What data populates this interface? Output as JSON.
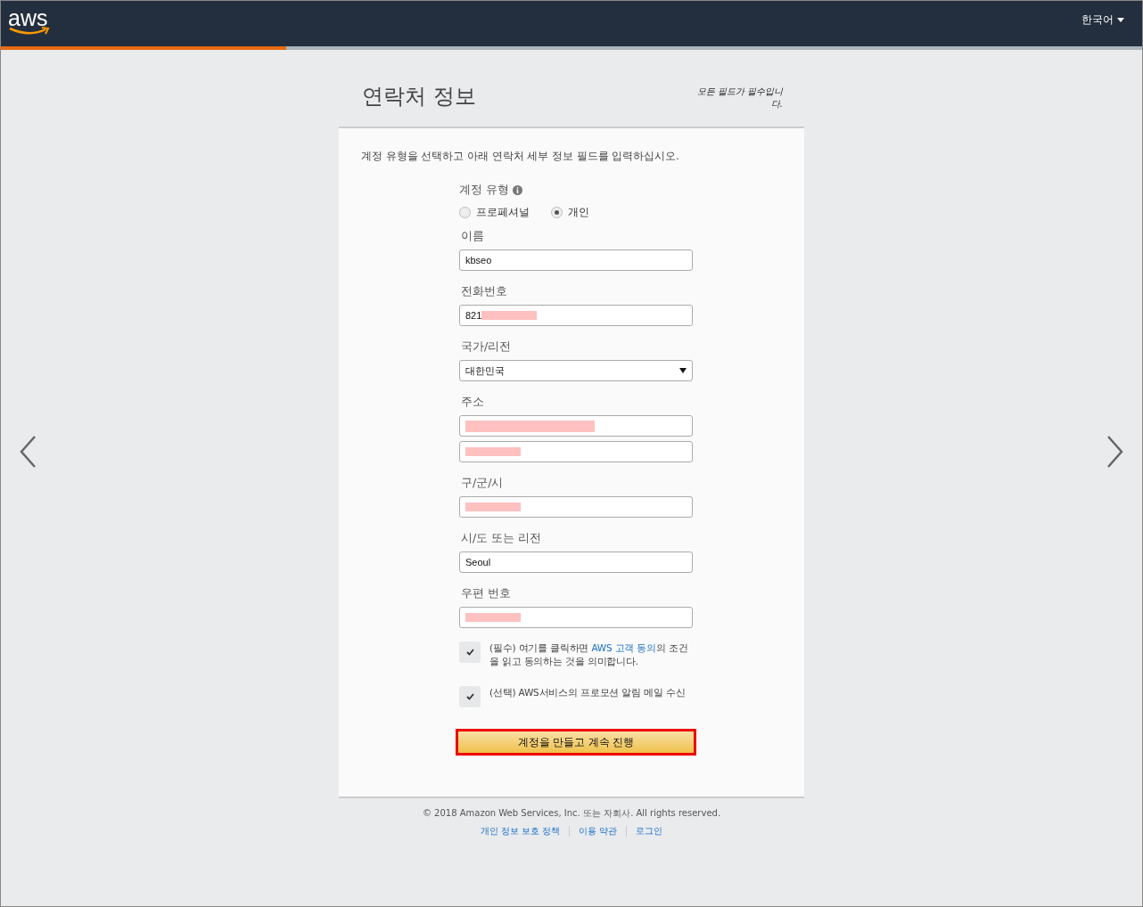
{
  "header": {
    "logo": "aws",
    "language": "한국어"
  },
  "progress": {
    "level": 0.25
  },
  "title": "연락처 정보",
  "required_note": "모든 필드가 필수입니다.",
  "intro": "계정 유형을 선택하고 아래 연락처 세부 정보 필드를 입력하십시오.",
  "account_type": {
    "label": "계정 유형",
    "options": [
      {
        "label": "프로페셔널",
        "selected": false
      },
      {
        "label": "개인",
        "selected": true
      }
    ]
  },
  "fields": [
    {
      "label": "이름",
      "kind": "text",
      "inputs": [
        {
          "value": "kbseo",
          "redacted": false
        }
      ]
    },
    {
      "label": "전화번호",
      "kind": "text",
      "inputs": [
        {
          "value": "821",
          "redacted": true
        }
      ]
    },
    {
      "label": "국가/리전",
      "kind": "select",
      "inputs": [
        {
          "value": "대한민국",
          "redacted": false
        }
      ]
    },
    {
      "label": "주소",
      "kind": "text",
      "inputs": [
        {
          "redacted": true
        },
        {
          "redacted": true
        }
      ]
    },
    {
      "label": "구/군/시",
      "kind": "text",
      "inputs": [
        {
          "redacted": true
        }
      ]
    },
    {
      "label": "시/도 또는 리전",
      "kind": "text",
      "inputs": [
        {
          "value": "Seoul",
          "redacted": false
        }
      ]
    },
    {
      "label": "우편 번호",
      "kind": "text",
      "inputs": [
        {
          "redacted": true
        }
      ]
    }
  ],
  "agreements": [
    {
      "checked": true,
      "before": "(필수) 여기를 클릭하면 ",
      "link": "AWS 고객 동의",
      "after": "의 조건을 읽고 동의하는 것을 의미합니다."
    },
    {
      "checked": true,
      "before": "(선택) AWS서비스의 프로모션 알림 메일 수신"
    }
  ],
  "submit": {
    "label": "계정을 만들고 계속 진행",
    "highlighted": true
  },
  "footer": {
    "copyright": "© 2018 Amazon Web Services, Inc. 또는 자회사. All rights reserved.",
    "links": [
      "개인 정보 보호 정책",
      "이용 약관",
      "로그인"
    ]
  }
}
